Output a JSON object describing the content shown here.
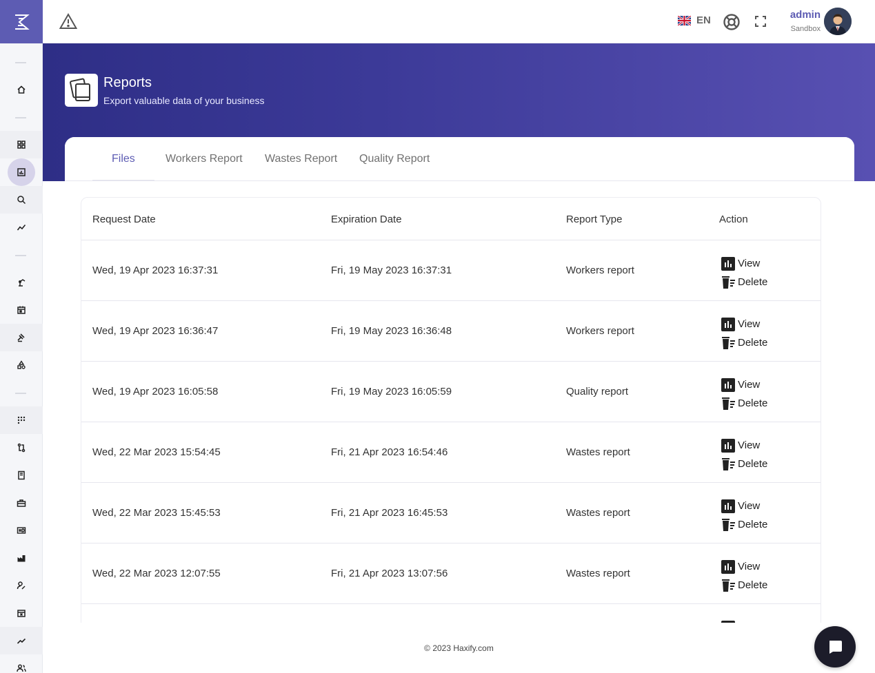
{
  "app": {
    "logo_icon": "haxify-logo-icon"
  },
  "topbar": {
    "warning_icon": "warning-triangle-icon",
    "language": {
      "flag_icon": "uk-flag-icon",
      "label": "EN"
    },
    "help_icon": "lifebuoy-icon",
    "fullscreen_icon": "fullscreen-icon",
    "user": {
      "name": "admin",
      "role": "Sandbox",
      "avatar_icon": "user-avatar"
    }
  },
  "sidebar": {
    "items": [
      {
        "icon": "home-icon"
      },
      {
        "icon": "dashboard-icon"
      },
      {
        "icon": "reports-icon",
        "active": true
      },
      {
        "icon": "search-analysis-icon"
      },
      {
        "icon": "trend-icon"
      },
      {
        "icon": "robot-arm-icon"
      },
      {
        "icon": "calendar-icon"
      },
      {
        "icon": "gavel-icon"
      },
      {
        "icon": "shapes-icon"
      },
      {
        "icon": "grid-icon"
      },
      {
        "icon": "route-icon"
      },
      {
        "icon": "book-icon"
      },
      {
        "icon": "toolbox-icon"
      },
      {
        "icon": "hd-icon"
      },
      {
        "icon": "factory-icon"
      },
      {
        "icon": "user-edit-icon"
      },
      {
        "icon": "calendar-x-icon"
      },
      {
        "icon": "chart-line-icon"
      },
      {
        "icon": "users-icon"
      }
    ]
  },
  "header": {
    "page_icon": "copy-files-icon",
    "title": "Reports",
    "subtitle": "Export valuable data of your business"
  },
  "tabs": [
    {
      "label": "Files",
      "active": true
    },
    {
      "label": "Workers Report"
    },
    {
      "label": "Wastes Report"
    },
    {
      "label": "Quality Report"
    }
  ],
  "table": {
    "columns": [
      "Request Date",
      "Expiration Date",
      "Report Type",
      "Action"
    ],
    "view_label": "View",
    "delete_label": "Delete",
    "rows": [
      {
        "request": "Wed, 19 Apr 2023 16:37:31",
        "expiration": "Fri, 19 May 2023 16:37:31",
        "type": "Workers report"
      },
      {
        "request": "Wed, 19 Apr 2023 16:36:47",
        "expiration": "Fri, 19 May 2023 16:36:48",
        "type": "Workers report"
      },
      {
        "request": "Wed, 19 Apr 2023 16:05:58",
        "expiration": "Fri, 19 May 2023 16:05:59",
        "type": "Quality report"
      },
      {
        "request": "Wed, 22 Mar 2023 15:54:45",
        "expiration": "Fri, 21 Apr 2023 16:54:46",
        "type": "Wastes report"
      },
      {
        "request": "Wed, 22 Mar 2023 15:45:53",
        "expiration": "Fri, 21 Apr 2023 16:45:53",
        "type": "Wastes report"
      },
      {
        "request": "Wed, 22 Mar 2023 12:07:55",
        "expiration": "Fri, 21 Apr 2023 13:07:56",
        "type": "Wastes report"
      }
    ]
  },
  "footer": {
    "copyright": "© 2023 Haxify.com"
  },
  "chat": {
    "icon": "chat-bubble-icon"
  },
  "colors": {
    "accent": "#5d5cb3",
    "banner_start": "#2e2e86",
    "banner_end": "#5850b2"
  }
}
